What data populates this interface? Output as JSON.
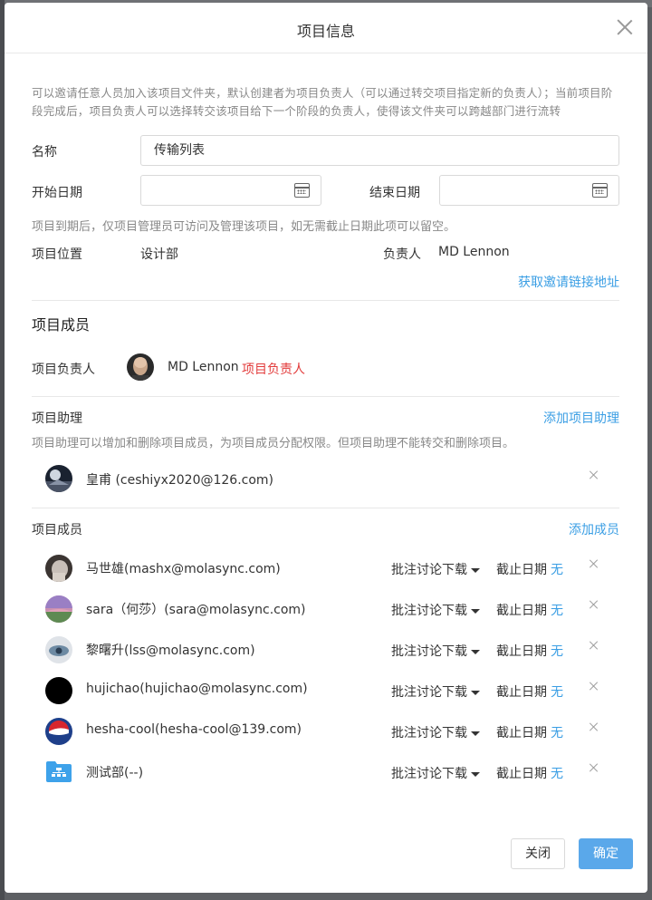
{
  "dialog": {
    "title": "项目信息",
    "intro": "可以邀请任意人员加入该项目文件夹，默认创建者为项目负责人（可以通过转交项目指定新的负责人）；当前项目阶段完成后，项目负责人可以选择转交该项目给下一个阶段的负责人，使得该文件夹可以跨越部门进行流转"
  },
  "form": {
    "name_label": "名称",
    "name_value": "传输列表",
    "start_label": "开始日期",
    "start_value": "",
    "end_label": "结束日期",
    "end_value": "",
    "date_hint": "项目到期后，仅项目管理员可访问及管理该项目，如无需截止日期此项可以留空。",
    "location_label": "项目位置",
    "location_value": "设计部",
    "owner_label": "负责人",
    "owner_value": "MD Lennon",
    "invite_link": "获取邀请链接地址"
  },
  "members_section": {
    "title": "项目成员",
    "owner_row_label": "项目负责人",
    "owner_name": "MD Lennon",
    "owner_tag": "项目负责人"
  },
  "assistants": {
    "title": "项目助理",
    "add_link": "添加项目助理",
    "hint": "项目助理可以增加和删除项目成员，为项目成员分配权限。但项目助理不能转交和删除项目。",
    "items": [
      {
        "name": "皇甫   (ceshiyx2020@126.com)"
      }
    ]
  },
  "members": {
    "title": "项目成员",
    "add_link": "添加成员",
    "perm_label": "批注讨论下载",
    "deadline_label": "截止日期",
    "deadline_value": "无",
    "items": [
      {
        "name": "马世雄(mashx@molasync.com)"
      },
      {
        "name": "sara（何莎）(sara@molasync.com)"
      },
      {
        "name": "黎曙升(lss@molasync.com)"
      },
      {
        "name": "hujichao(hujichao@molasync.com)"
      },
      {
        "name": "hesha-cool(hesha-cool@139.com)"
      },
      {
        "name": "测试部(--)"
      }
    ]
  },
  "footer": {
    "close_label": "关闭",
    "ok_label": "确定"
  },
  "colors": {
    "accent": "#3a9ee4",
    "primary_button": "#5aa8ea",
    "owner_tag": "#e23b3b"
  }
}
